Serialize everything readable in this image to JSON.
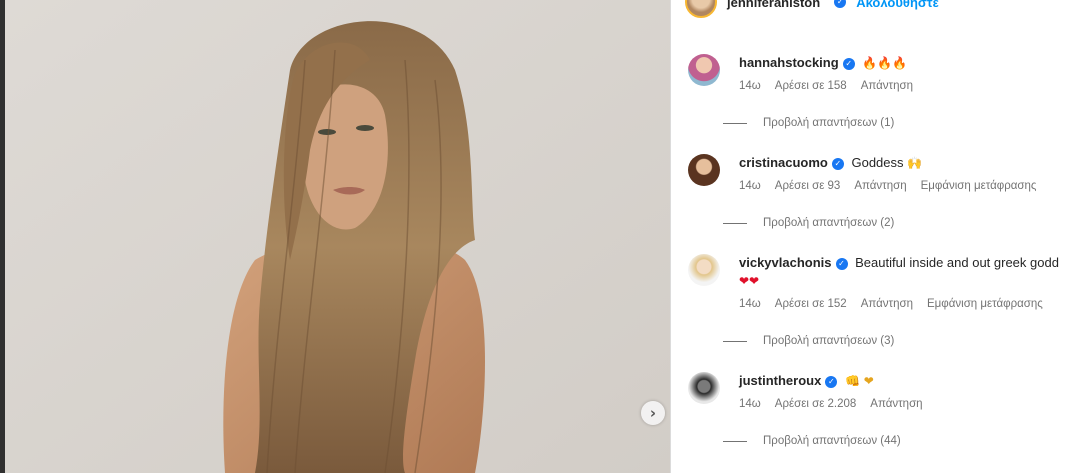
{
  "post": {
    "author": "jenniferaniston",
    "follow_label": "Ακολουθήστε",
    "next_icon": "chevron-right-icon"
  },
  "comments": [
    {
      "username": "hannahstocking",
      "verified": true,
      "text": "",
      "emoji": "🔥🔥🔥",
      "time": "14ω",
      "likes": "Αρέσει σε 158",
      "reply": "Απάντηση",
      "translate": "",
      "view_replies": "Προβολή απαντήσεων (1)",
      "avatar_color": "#b46a8a"
    },
    {
      "username": "cristinacuomo",
      "verified": true,
      "text": "Goddess",
      "emoji": "🙌",
      "time": "14ω",
      "likes": "Αρέσει σε 93",
      "reply": "Απάντηση",
      "translate": "Εμφάνιση μετάφρασης",
      "view_replies": "Προβολή απαντήσεων (2)",
      "avatar_color": "#8a5a3c"
    },
    {
      "username": "vickyvlachonis",
      "verified": true,
      "text": "Beautiful inside and out greek godd",
      "emoji": "❤❤",
      "time": "14ω",
      "likes": "Αρέσει σε 152",
      "reply": "Απάντηση",
      "translate": "Εμφάνιση μετάφρασης",
      "view_replies": "Προβολή απαντήσεων (3)",
      "avatar_color": "#d8c08a"
    },
    {
      "username": "justintheroux",
      "verified": true,
      "text": "",
      "emoji": "👊 ❤",
      "time": "14ω",
      "likes": "Αρέσει σε 2.208",
      "reply": "Απάντηση",
      "translate": "",
      "view_replies": "Προβολή απαντήσεων (44)",
      "avatar_color": "#2a2a2a"
    }
  ]
}
